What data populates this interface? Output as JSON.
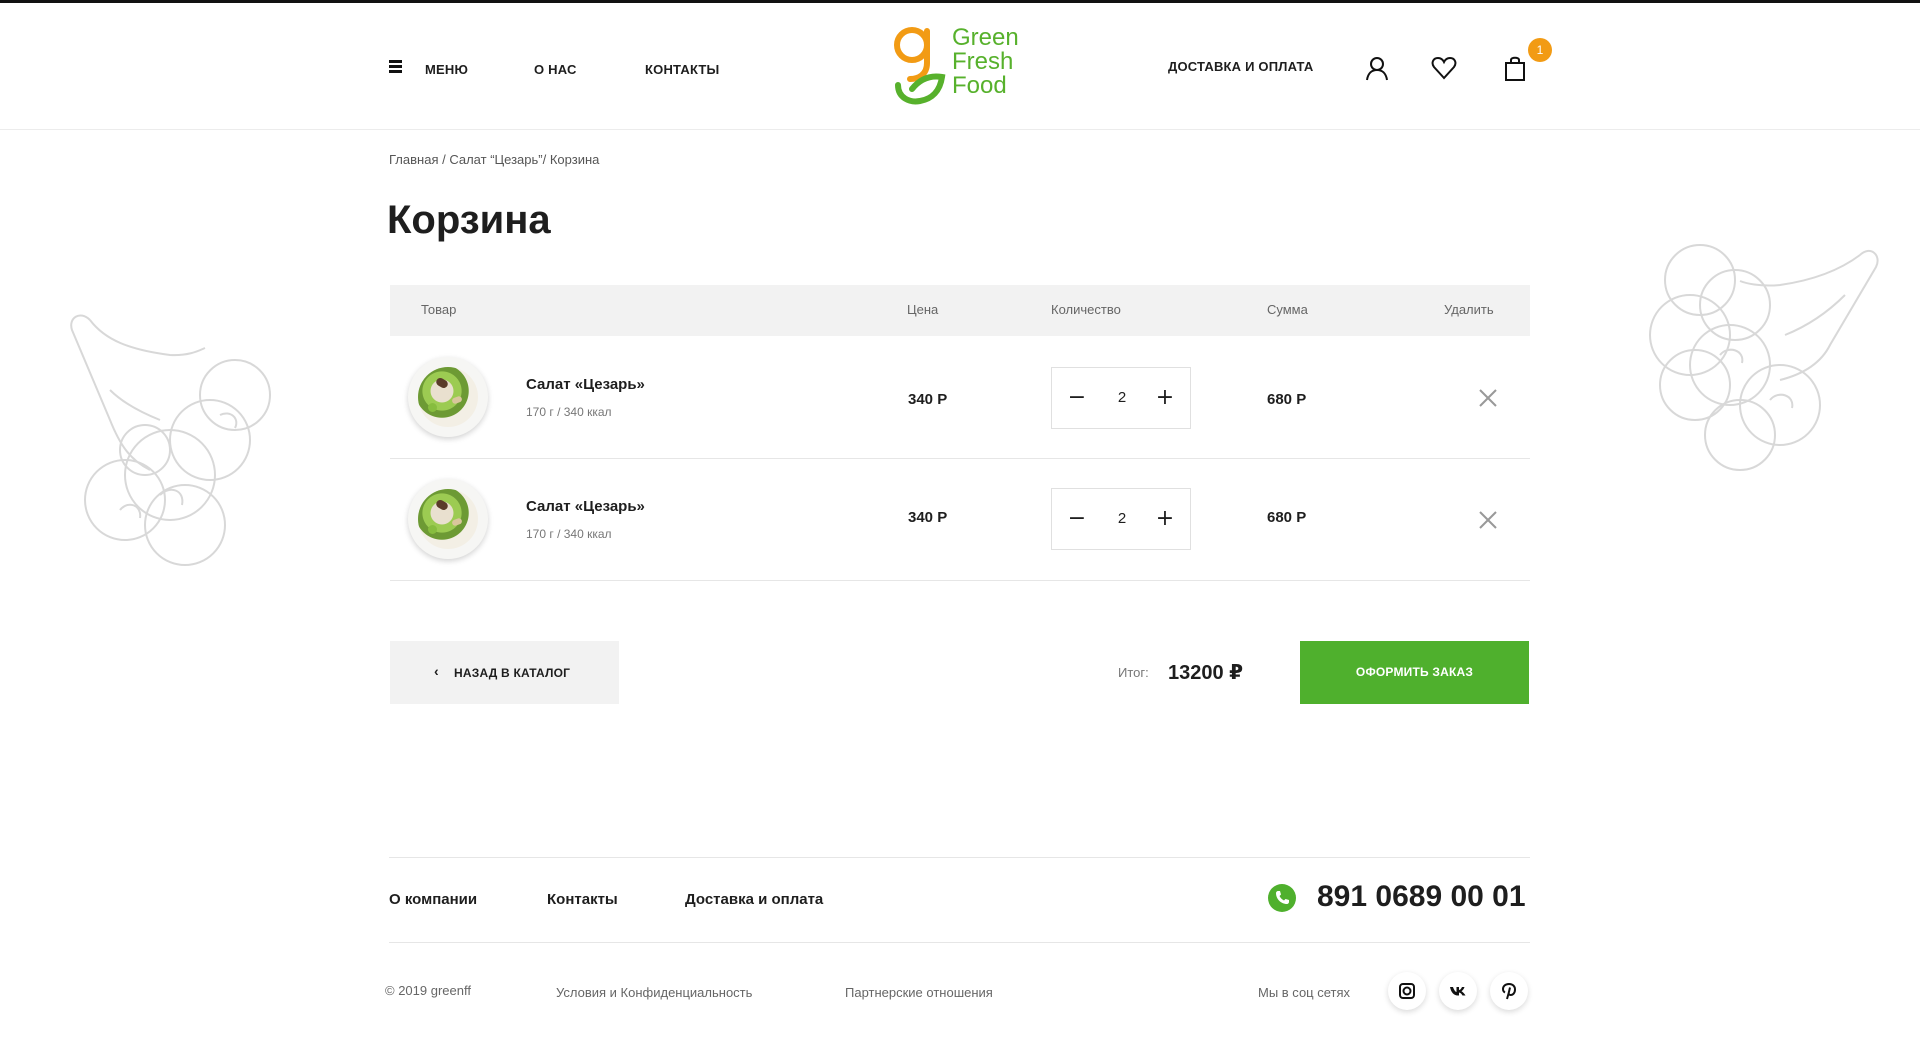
{
  "header": {
    "nav": {
      "menu": "МЕНЮ",
      "about": "О НАС",
      "contacts": "КОНТАКТЫ",
      "delivery": "ДОСТАВКА И ОПЛАТА"
    },
    "logo": {
      "line1": "Green",
      "line2": "Fresh",
      "line3": "Food"
    },
    "cart_count": "1",
    "icons": [
      "menu-icon",
      "user-icon",
      "heart-icon",
      "cart-icon"
    ]
  },
  "breadcrumb": {
    "home": "Главная",
    "sep1": " / ",
    "product": "Салат “Цезарь”",
    "sep2": "/ ",
    "current": "Корзина"
  },
  "page_title": "Корзина",
  "table": {
    "headers": {
      "product": "Товар",
      "price": "Цена",
      "qty": "Количество",
      "sum": "Сумма",
      "remove": "Удалить"
    },
    "rows": [
      {
        "name": "Салат «Цезарь»",
        "meta": "170 г / 340 ккал",
        "price": "340 Р",
        "qty": "2",
        "sum": "680 Р"
      },
      {
        "name": "Салат «Цезарь»",
        "meta": "170 г / 340 ккал",
        "price": "340 Р",
        "qty": "2",
        "sum": "680 Р"
      }
    ],
    "minus": "−",
    "plus": "+"
  },
  "actions": {
    "back_chevron": "‹",
    "back_label": "НАЗАД В КАТАЛОГ",
    "total_label": "Итог:",
    "total_value": "13200 ₽",
    "order_label": "ОФОРМИТЬ ЗАКАЗ"
  },
  "footer": {
    "links": {
      "company": "О компании",
      "contacts": "Контакты",
      "delivery": "Доставка и оплата"
    },
    "phone": "891 0689 00 01",
    "copyright": "© 2019 greenff",
    "terms": "Условия и Конфиденциальность",
    "partners": "Партнерские отношения",
    "social_label": "Мы в соц сетях",
    "social_icons": [
      "instagram-icon",
      "vk-icon",
      "pinterest-icon"
    ]
  },
  "colors": {
    "brand_green": "#4fb02d",
    "logo_orange": "#f29b14",
    "text": "#1e1e1e"
  }
}
